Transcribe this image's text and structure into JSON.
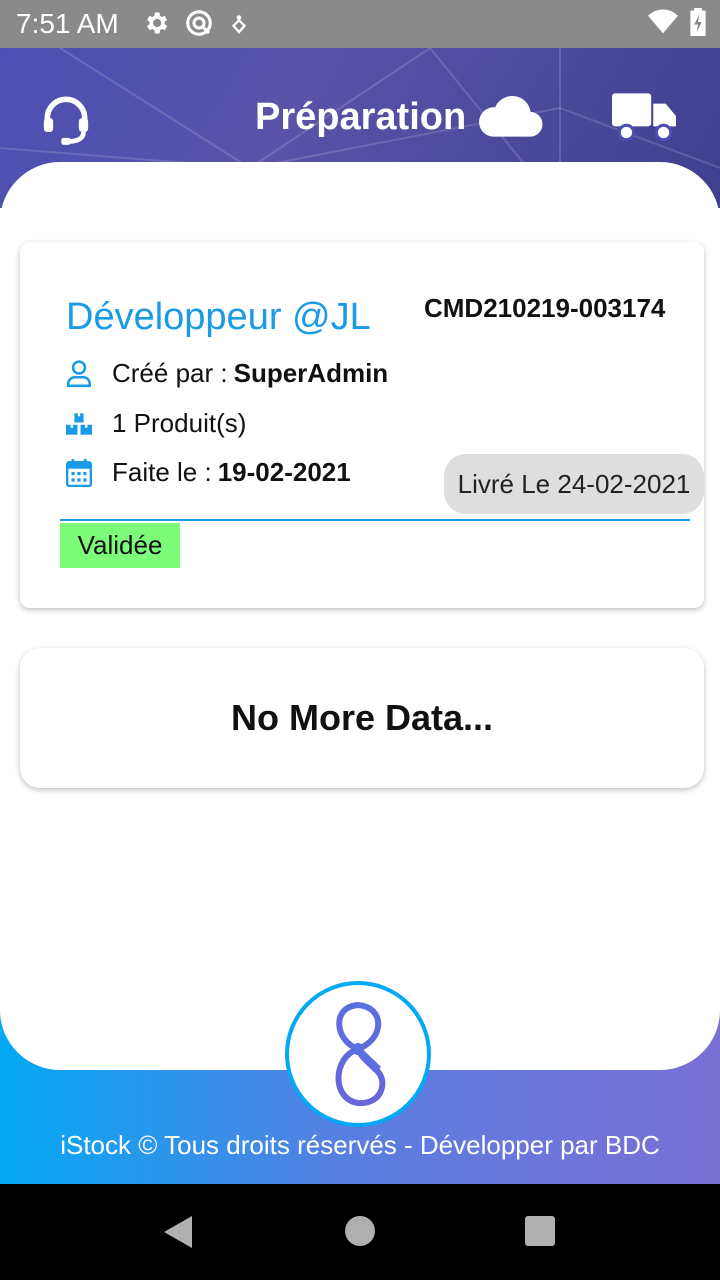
{
  "status_bar": {
    "time": "7:51 AM",
    "icons_left": [
      "settings-icon",
      "sync-icon",
      "location-icon"
    ],
    "icons_right": [
      "wifi-icon",
      "battery-icon"
    ]
  },
  "header": {
    "title": "Préparation",
    "left_icon": "headset-icon",
    "title_icon": "cloud-icon",
    "right_icon": "truck-icon"
  },
  "order": {
    "client_name": "Développeur @JL",
    "code": "CMD210219-003174",
    "created_by_label": "Créé par :",
    "created_by": "SuperAdmin",
    "products": "1 Produit(s)",
    "made_on_label": "Faite le :",
    "made_on": "19-02-2021",
    "delivered": "Livré Le 24-02-2021",
    "status": "Validée"
  },
  "list_end": {
    "message": "No More Data..."
  },
  "footer": {
    "text": "iStock © Tous droits réservés - Développer par BDC"
  },
  "colors": {
    "accent": "#1a9be6",
    "status_green": "#7dfc7a",
    "header_bg": "#4b4fb4"
  }
}
